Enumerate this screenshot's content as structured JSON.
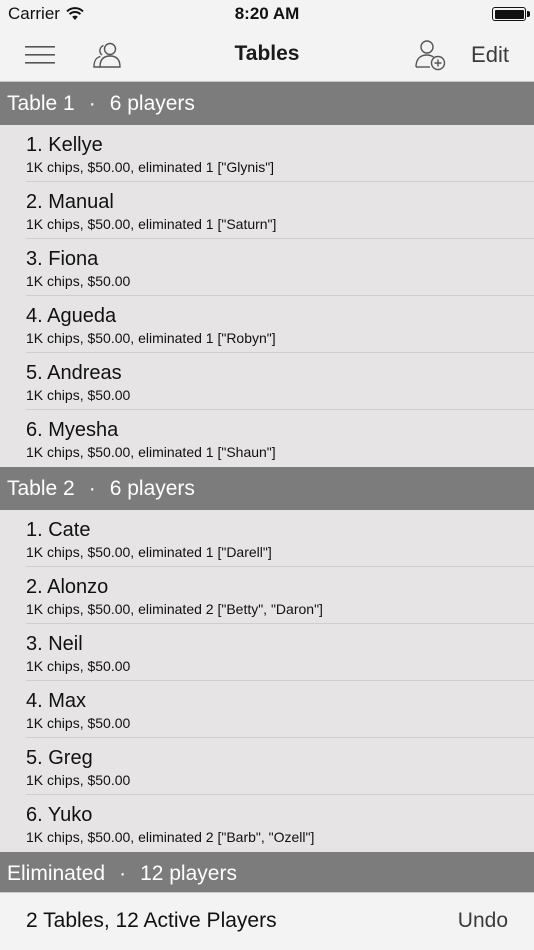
{
  "status_bar": {
    "carrier": "Carrier",
    "time": "8:20 AM"
  },
  "nav": {
    "title": "Tables",
    "edit_label": "Edit"
  },
  "tables": [
    {
      "name": "Table 1",
      "separator": "·",
      "count": "6 players",
      "players": [
        {
          "title": "1. Kellye",
          "subtitle": "1K chips, $50.00, eliminated 1 [\"Glynis\"]"
        },
        {
          "title": "2. Manual",
          "subtitle": "1K chips, $50.00, eliminated 1 [\"Saturn\"]"
        },
        {
          "title": "3. Fiona",
          "subtitle": "1K chips, $50.00"
        },
        {
          "title": "4. Agueda",
          "subtitle": "1K chips, $50.00, eliminated 1 [\"Robyn\"]"
        },
        {
          "title": "5. Andreas",
          "subtitle": "1K chips, $50.00"
        },
        {
          "title": "6. Myesha",
          "subtitle": "1K chips, $50.00, eliminated 1 [\"Shaun\"]"
        }
      ]
    },
    {
      "name": "Table 2",
      "separator": "·",
      "count": "6 players",
      "players": [
        {
          "title": "1. Cate",
          "subtitle": "1K chips, $50.00, eliminated 1 [\"Darell\"]"
        },
        {
          "title": "2. Alonzo",
          "subtitle": "1K chips, $50.00, eliminated 2 [\"Betty\", \"Daron\"]"
        },
        {
          "title": "3. Neil",
          "subtitle": "1K chips, $50.00"
        },
        {
          "title": "4. Max",
          "subtitle": "1K chips, $50.00"
        },
        {
          "title": "5. Greg",
          "subtitle": "1K chips, $50.00"
        },
        {
          "title": "6. Yuko",
          "subtitle": "1K chips, $50.00, eliminated 2 [\"Barb\", \"Ozell\"]"
        }
      ]
    }
  ],
  "eliminated": {
    "name": "Eliminated",
    "separator": "·",
    "count": "12 players"
  },
  "bottom": {
    "status": "2 Tables, 12 Active Players",
    "undo_label": "Undo"
  }
}
